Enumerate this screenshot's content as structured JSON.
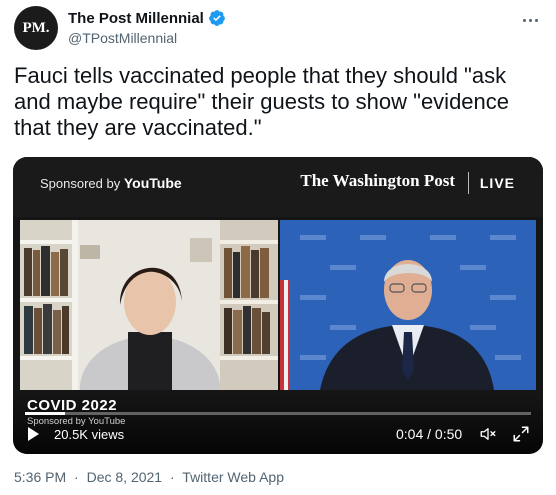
{
  "author": {
    "avatar_text": "PM.",
    "name": "The Post Millennial",
    "handle": "@TPostMillennial"
  },
  "tweet": {
    "text": "Fauci tells vaccinated people that they should \"ask and maybe require\" their guests to show \"evidence that they are vaccinated.\""
  },
  "video": {
    "sponsored_prefix": "Sponsored by",
    "sponsored_brand": "YouTube",
    "publisher": "The Washington Post",
    "live_label": "LIVE",
    "caption_title": "COVID 2022",
    "caption_sub": "Sponsored by YouTube",
    "views": "20.5K views",
    "time": "0:04 / 0:50",
    "progress": 0.08
  },
  "footer": {
    "time": "5:36 PM",
    "sep1": "·",
    "date": "Dec 8, 2021",
    "sep2": "·",
    "source": "Twitter Web App"
  },
  "colors": {
    "verified": "#1d9bf0",
    "secondary_text": "#536471"
  }
}
